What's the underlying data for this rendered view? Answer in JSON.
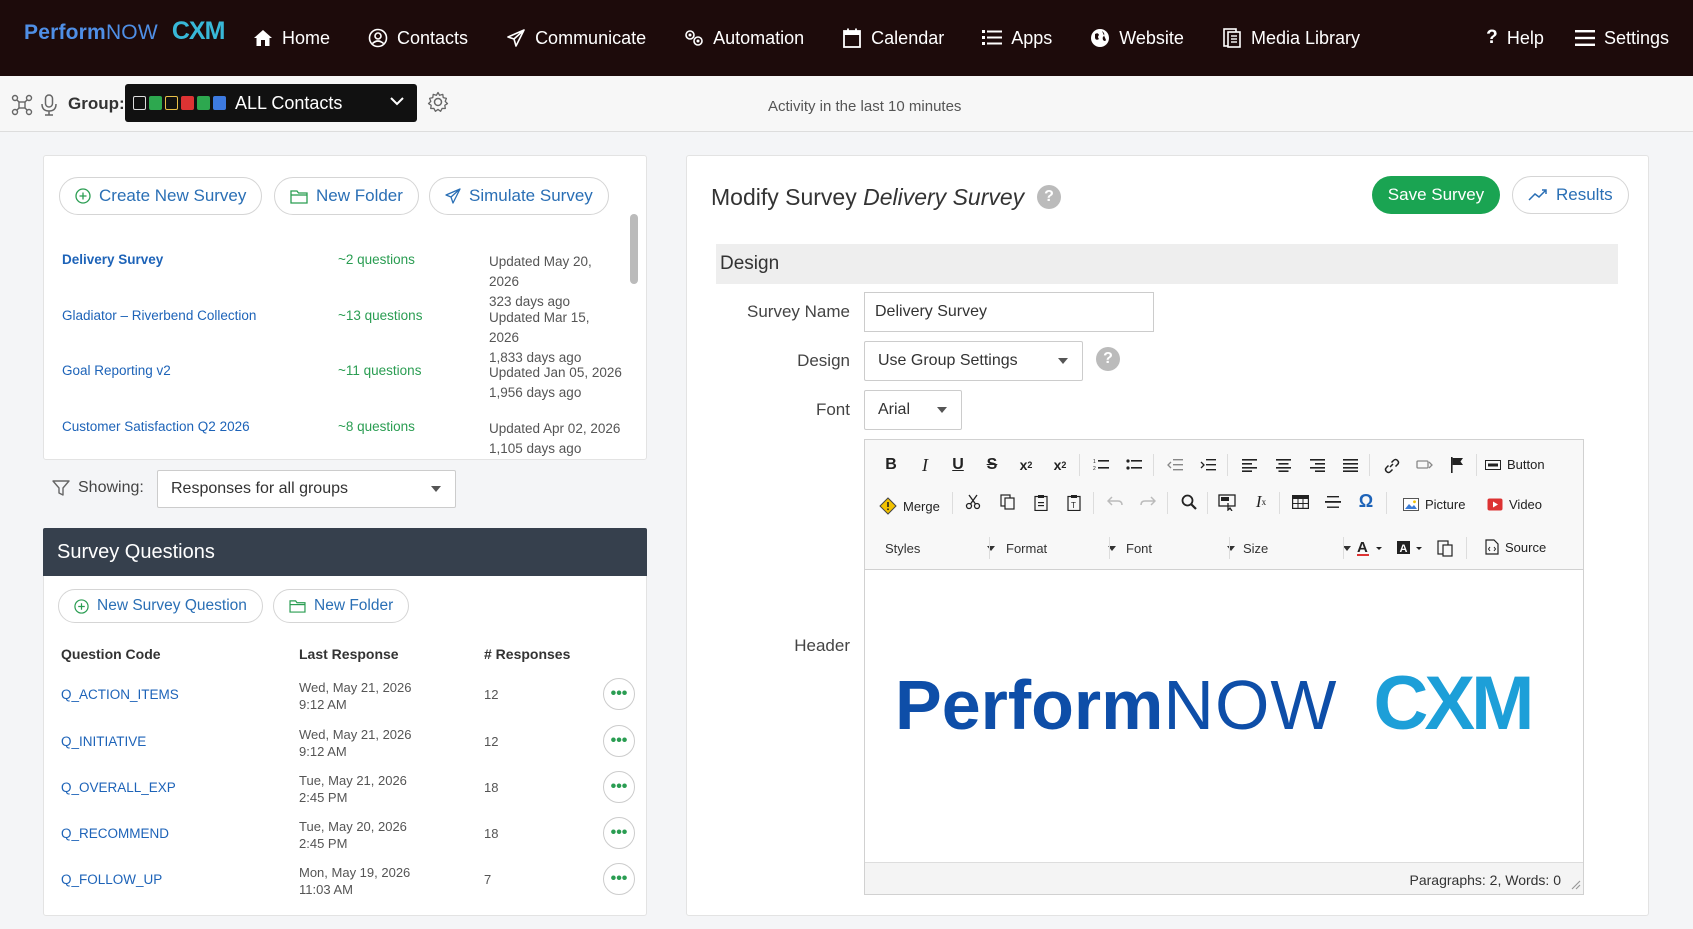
{
  "app": {
    "brand_perform": "Perform",
    "brand_now": "NOW",
    "brand_cxm": "CXM"
  },
  "nav": {
    "items": [
      {
        "label": "Home",
        "icon": "home-icon"
      },
      {
        "label": "Contacts",
        "icon": "contact-icon"
      },
      {
        "label": "Communicate",
        "icon": "send-icon"
      },
      {
        "label": "Automation",
        "icon": "gears-icon"
      },
      {
        "label": "Calendar",
        "icon": "calendar-icon"
      },
      {
        "label": "Apps",
        "icon": "list-icon"
      },
      {
        "label": "Website",
        "icon": "globe-icon"
      },
      {
        "label": "Media Library",
        "icon": "media-icon"
      }
    ],
    "help": "Help",
    "settings": "Settings"
  },
  "subbar": {
    "group_label": "Group:",
    "group_value": "ALL Contacts",
    "activity": "Activity in the last 10 minutes"
  },
  "surveys_panel": {
    "create_label": "Create New Survey",
    "folder_label": "New Folder",
    "simulate_label": "Simulate Survey",
    "rows": [
      {
        "name": "Delivery Survey",
        "questions": "~2 questions",
        "updated": "Updated May 20, 2026",
        "ago": "323 days ago"
      },
      {
        "name": "Gladiator – Riverbend Collection",
        "questions": "~13 questions",
        "updated": "Updated Mar 15, 2026",
        "ago": "1,833 days ago"
      },
      {
        "name": "Goal Reporting v2",
        "questions": "~11 questions",
        "updated": "Updated Jan 05, 2026",
        "ago": "1,956 days ago"
      },
      {
        "name": "Customer Satisfaction Q2 2026",
        "questions": "~8 questions",
        "updated": "Updated Apr 02, 2026",
        "ago": "1,105 days ago"
      }
    ]
  },
  "filter": {
    "showing_label": "Showing:",
    "value": "Responses for all groups"
  },
  "questions_panel": {
    "title": "Survey Questions",
    "new_question_label": "New Survey Question",
    "folder_label": "New Folder",
    "headers": [
      "Question Code",
      "Last Response",
      "# Responses"
    ],
    "rows": [
      {
        "code": "Q_ACTION_ITEMS",
        "date": "Wed, May 21, 2026",
        "time": "9:12 AM",
        "responses": "12"
      },
      {
        "code": "Q_INITIATIVE",
        "date": "Wed, May 21, 2026",
        "time": "9:12 AM",
        "responses": "12"
      },
      {
        "code": "Q_OVERALL_EXP",
        "date": "Tue, May 21, 2026",
        "time": "2:45 PM",
        "responses": "18"
      },
      {
        "code": "Q_RECOMMEND",
        "date": "Tue, May 20, 2026",
        "time": "2:45 PM",
        "responses": "18"
      },
      {
        "code": "Q_FOLLOW_UP",
        "date": "Mon, May 19, 2026",
        "time": "11:03 AM",
        "responses": "7"
      }
    ]
  },
  "modify": {
    "title_prefix": "Modify Survey",
    "title_name": "Delivery Survey",
    "save_label": "Save Survey",
    "results_label": "Results",
    "section": "Design",
    "survey_name_label": "Survey Name",
    "survey_name_value": "Delivery Survey",
    "design_label": "Design",
    "design_value": "Use Group Settings",
    "font_label": "Font",
    "font_value": "Arial",
    "header_label": "Header"
  },
  "editor": {
    "button_label": "Button",
    "merge_label": "Merge",
    "picture_label": "Picture",
    "video_label": "Video",
    "styles_label": "Styles",
    "format_label": "Format",
    "font_label": "Font",
    "size_label": "Size",
    "source_label": "Source",
    "status": "Paragraphs: 2, Words: 0"
  },
  "colors": {
    "nav_bg": "#1d0b0b",
    "link": "#1d63b8",
    "green": "#1aa452",
    "logo_blue": "#0e4ea8"
  }
}
